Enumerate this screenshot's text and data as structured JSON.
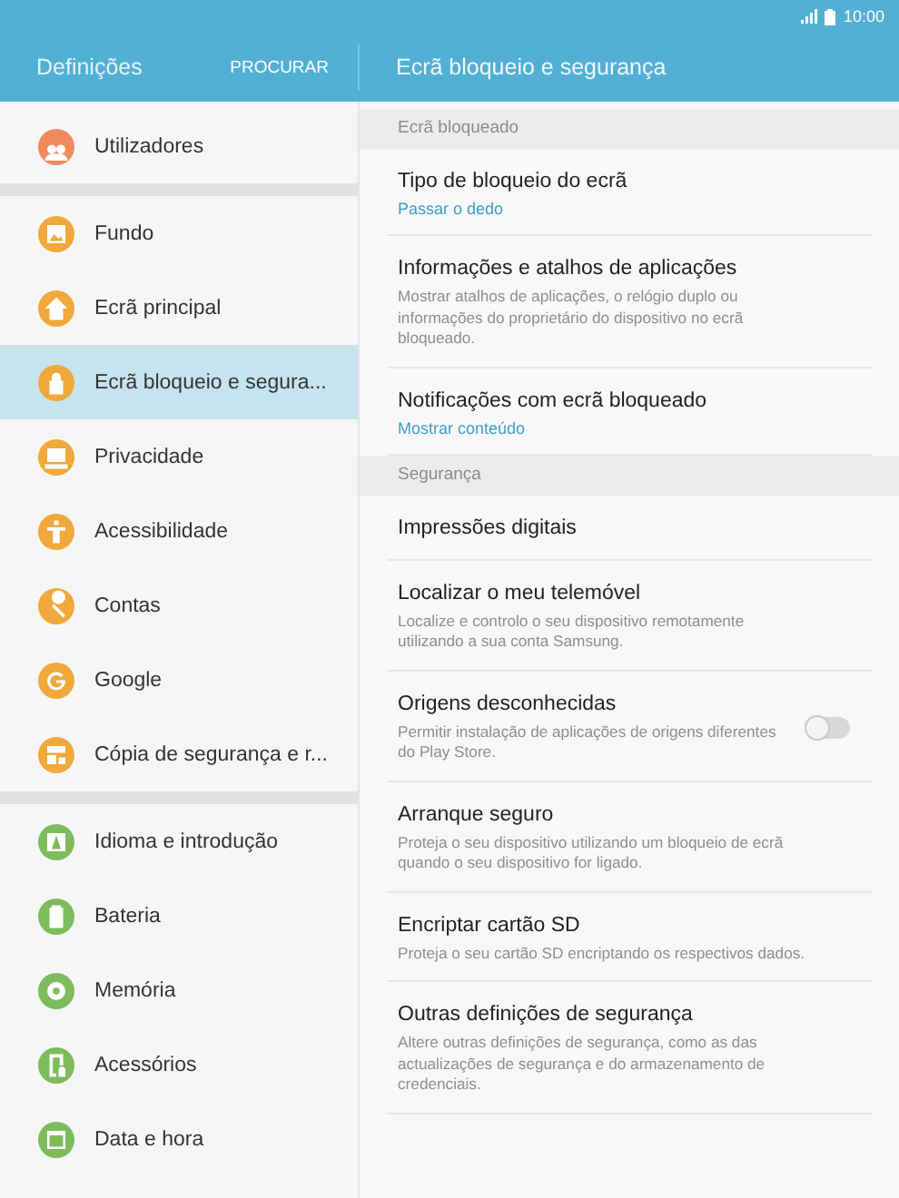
{
  "status_bar": {
    "time": "10:00"
  },
  "header": {
    "title": "Definições",
    "search": "PROCURAR",
    "detail_title": "Ecrã bloqueio e segurança"
  },
  "sidebar": {
    "groups": [
      {
        "items": [
          {
            "label": "Utilizadores",
            "color": "#ee8a5c",
            "selected": false
          }
        ]
      },
      {
        "items": [
          {
            "label": "Fundo",
            "color": "#f0a93a",
            "selected": false
          },
          {
            "label": "Ecrã principal",
            "color": "#f0a93a",
            "selected": false
          },
          {
            "label": "Ecrã bloqueio e segura...",
            "color": "#f0a93a",
            "selected": true
          },
          {
            "label": "Privacidade",
            "color": "#f0a93a",
            "selected": false
          },
          {
            "label": "Acessibilidade",
            "color": "#f0a93a",
            "selected": false
          },
          {
            "label": "Contas",
            "color": "#f0a93a",
            "selected": false
          },
          {
            "label": "Google",
            "color": "#f0a93a",
            "selected": false
          },
          {
            "label": "Cópia de segurança e r...",
            "color": "#f0a93a",
            "selected": false
          }
        ]
      },
      {
        "items": [
          {
            "label": "Idioma e introdução",
            "color": "#7dbb5c",
            "selected": false
          },
          {
            "label": "Bateria",
            "color": "#7dbb5c",
            "selected": false
          },
          {
            "label": "Memória",
            "color": "#7dbb5c",
            "selected": false
          },
          {
            "label": "Acessórios",
            "color": "#7dbb5c",
            "selected": false
          },
          {
            "label": "Data e hora",
            "color": "#7dbb5c",
            "selected": false
          }
        ]
      }
    ]
  },
  "detail": {
    "rows": [
      {
        "kind": "header",
        "title": "Ecrã bloqueado"
      },
      {
        "kind": "setting",
        "title": "Tipo de bloqueio do ecrã",
        "value": "Passar o dedo"
      },
      {
        "kind": "setting",
        "title": "Informações e atalhos de aplicações",
        "summary": "Mostrar atalhos de aplicações, o relógio duplo ou informações do proprietário do dispositivo no ecrã bloqueado."
      },
      {
        "kind": "setting",
        "title": "Notificações com ecrã bloqueado",
        "value": "Mostrar conteúdo"
      },
      {
        "kind": "header",
        "title": "Segurança"
      },
      {
        "kind": "setting",
        "title": "Impressões digitais"
      },
      {
        "kind": "setting",
        "title": "Localizar o meu telemóvel",
        "summary": "Localize e controlo o seu dispositivo remotamente utilizando a sua conta Samsung."
      },
      {
        "kind": "toggle",
        "title": "Origens desconhecidas",
        "summary": "Permitir instalação de aplicações de origens diferentes do Play Store.",
        "on": false
      },
      {
        "kind": "setting",
        "title": "Arranque seguro",
        "summary": "Proteja o seu dispositivo utilizando um bloqueio de ecrã quando o seu dispositivo for ligado."
      },
      {
        "kind": "setting",
        "title": "Encriptar cartão SD",
        "summary": "Proteja o seu cartão SD encriptando os respectivos dados."
      },
      {
        "kind": "setting",
        "title": "Outras definições de segurança",
        "summary": "Altere outras definições de segurança, como as das actualizações de segurança e do armazenamento de credenciais."
      }
    ]
  }
}
